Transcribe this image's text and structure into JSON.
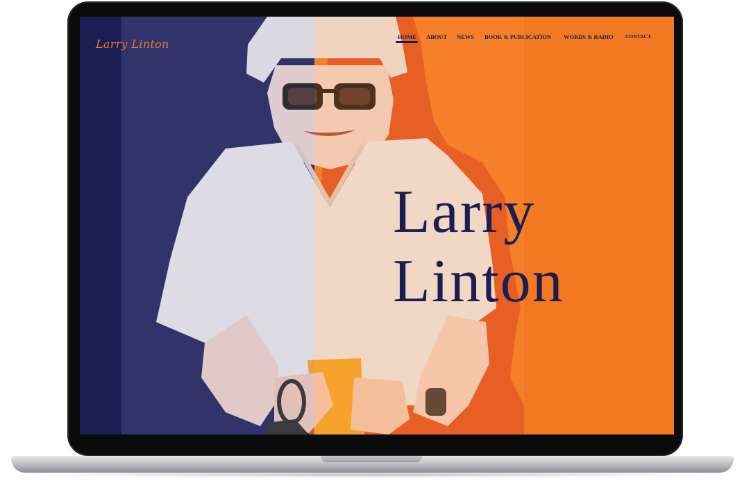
{
  "colors": {
    "navy": "#1b1e52",
    "orange": "#f27921",
    "logo_orange": "#e8782e"
  },
  "site": {
    "logo": "Larry Linton"
  },
  "nav": {
    "items": [
      {
        "label": "HOME",
        "active": true
      },
      {
        "label": "ABOUT"
      },
      {
        "label": "NEWS"
      },
      {
        "label": "BOOK & PUBLICATION"
      },
      {
        "label": "WORDS & RADIO"
      },
      {
        "label": "CONTACT"
      }
    ]
  },
  "hero": {
    "line1": "Larry",
    "line2": "Linton"
  }
}
